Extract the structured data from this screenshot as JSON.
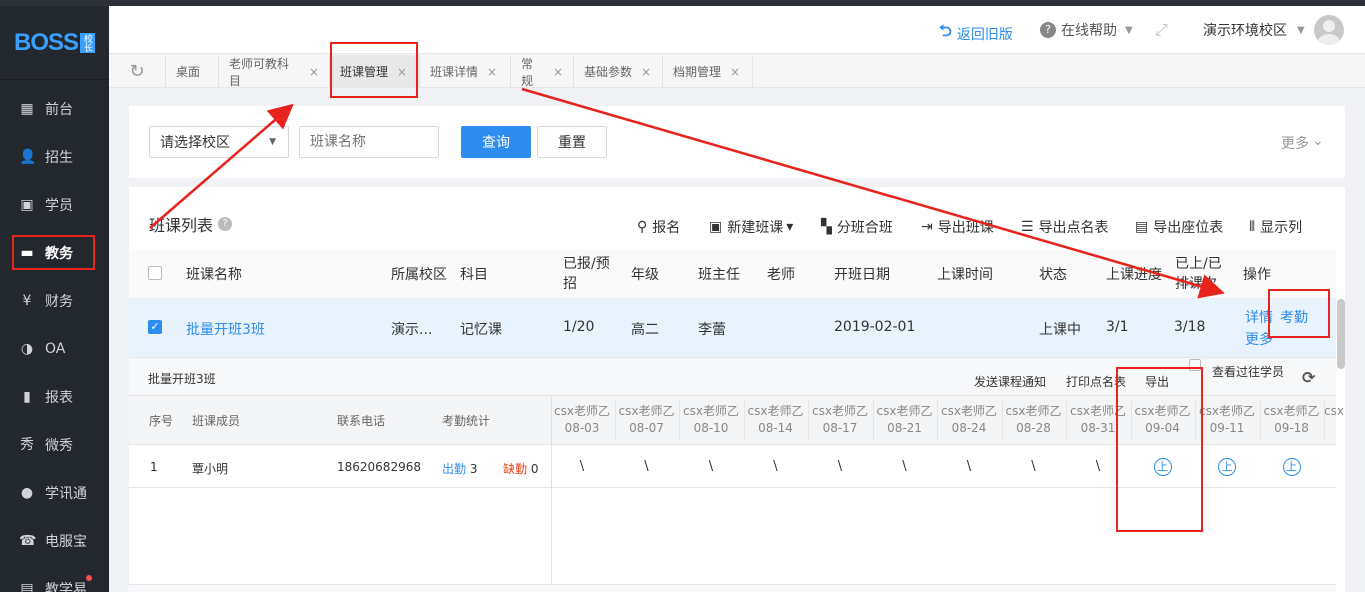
{
  "app": {
    "logo": "BOSS",
    "logo_badge": "校长"
  },
  "sidebar": {
    "items": [
      {
        "label": "前台",
        "icon": "calendar-icon"
      },
      {
        "label": "招生",
        "icon": "user-add-icon"
      },
      {
        "label": "学员",
        "icon": "id-card-icon"
      },
      {
        "label": "教务",
        "icon": "book-icon"
      },
      {
        "label": "财务",
        "icon": "yen-icon"
      },
      {
        "label": "OA",
        "icon": "oa-icon"
      },
      {
        "label": "报表",
        "icon": "bar-chart-icon"
      },
      {
        "label": "微秀",
        "icon": "show-icon"
      },
      {
        "label": "学讯通",
        "icon": "location-icon"
      },
      {
        "label": "电服宝",
        "icon": "phone-icon"
      },
      {
        "label": "教学易",
        "icon": "teach-icon"
      }
    ],
    "active": "教务"
  },
  "header": {
    "back_old": "返回旧版",
    "help": "在线帮助",
    "campus": "演示环境校区"
  },
  "tabs": [
    {
      "label": "桌面"
    },
    {
      "label": "老师可教科目"
    },
    {
      "label": "班课管理"
    },
    {
      "label": "班课详情"
    },
    {
      "label": "常规"
    },
    {
      "label": "基础参数"
    },
    {
      "label": "档期管理"
    }
  ],
  "filter": {
    "campus_select": "请选择校区",
    "class_name_placeholder": "班课名称",
    "query": "查询",
    "reset": "重置",
    "more": "更多"
  },
  "list": {
    "title": "班课列表",
    "tools": [
      "报名",
      "新建班课",
      "分班合班",
      "导出班课",
      "导出点名表",
      "导出座位表",
      "显示列"
    ],
    "columns": [
      "班课名称",
      "所属校区",
      "科目",
      "已报/预招",
      "年级",
      "班主任",
      "老师",
      "开班日期",
      "上课时间",
      "状态",
      "上课进度",
      "已上/已排课次",
      "操作"
    ],
    "row": {
      "name": "批量开班3班",
      "campus": "演示...",
      "subject": "记忆课",
      "enrolled": "1/20",
      "grade": "高二",
      "head_teacher": "李蕾",
      "teacher": "",
      "start_date": "2019-02-01",
      "class_time": "",
      "status": "上课中",
      "progress": "3/1",
      "lessons": "3/18",
      "op_detail": "详情",
      "op_attendance": "考勤",
      "op_more": "更多"
    }
  },
  "attendance": {
    "class_title": "批量开班3班",
    "actions": [
      "发送课程通知",
      "打印点名表",
      "导出"
    ],
    "show_past": "查看过往学员",
    "headers": {
      "index": "序号",
      "member": "班课成员",
      "phone": "联系电话",
      "stats": "考勤统计"
    },
    "teacher": "csx老师乙",
    "dates": [
      "08-03",
      "08-07",
      "08-10",
      "08-14",
      "08-17",
      "08-21",
      "08-24",
      "08-28",
      "08-31",
      "09-04",
      "09-11",
      "09-18"
    ],
    "student": {
      "index": "1",
      "name": "覃小明",
      "phone": "18620682968",
      "present_label": "出勤",
      "present": "3",
      "absent_label": "缺勤",
      "absent": "0",
      "past_mark": "\\",
      "future_mark": "上"
    }
  }
}
